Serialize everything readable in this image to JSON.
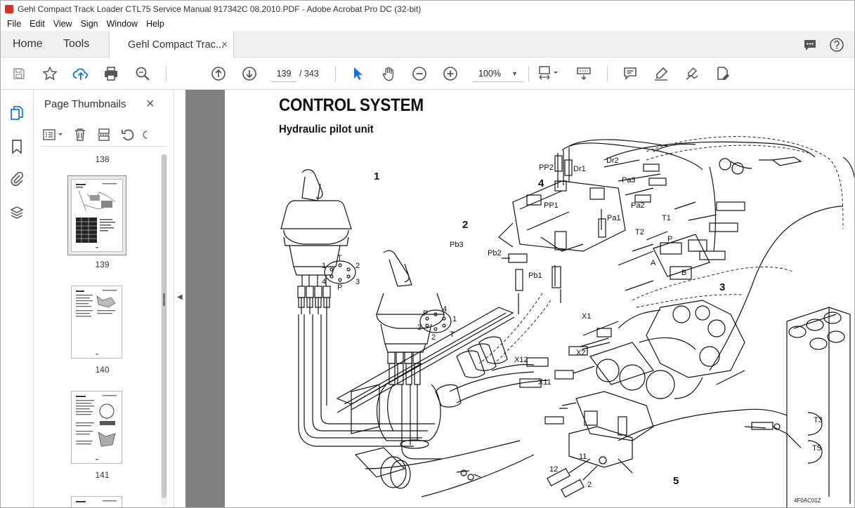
{
  "window": {
    "title": "Gehl Compact Track Loader CTL75 Service Manual 917342C 08.2010.PDF - Adobe Acrobat Pro DC (32-bit)"
  },
  "menu": [
    "File",
    "Edit",
    "View",
    "Sign",
    "Window",
    "Help"
  ],
  "tabs": {
    "home": "Home",
    "tools": "Tools",
    "document": "Gehl Compact Trac...",
    "close": "×"
  },
  "toolbar": {
    "current_page": "139",
    "total_pages": "/ 343",
    "zoom": "100%",
    "icons": [
      "save-icon",
      "bookmark-star-icon",
      "upload-icon",
      "print-icon",
      "find-icon",
      "prev-page-icon",
      "next-page-icon",
      "select-pointer-icon",
      "hand-icon",
      "zoom-out-icon",
      "zoom-in-icon",
      "page-fit-icon",
      "scroll-mode-icon",
      "comment-icon",
      "highlight-icon",
      "sign-icon",
      "edit-pdf-icon"
    ]
  },
  "left_rail": {
    "icons": [
      "pages-icon",
      "bookmark-icon",
      "attachment-icon",
      "layers-icon"
    ]
  },
  "thumbnails_panel": {
    "title": "Page Thumbnails",
    "close": "×",
    "pages": [
      {
        "label": "138"
      },
      {
        "label": "139",
        "selected": true
      },
      {
        "label": "140"
      },
      {
        "label": "141"
      }
    ]
  },
  "document": {
    "heading": "CONTROL SYSTEM",
    "subheading": "Hydraulic pilot unit",
    "diagram": {
      "callouts": [
        "1",
        "2",
        "3",
        "4",
        "5"
      ],
      "port_labels": [
        "PP2",
        "Dr1",
        "Dr2",
        "Pa3",
        "PP1",
        "Pa2",
        "Pa1",
        "T1",
        "T2",
        "P",
        "A",
        "B",
        "Pb3",
        "Pb2",
        "Pb1",
        "X1",
        "X2",
        "X12",
        "X11",
        "T3",
        "T5",
        "11",
        "12",
        "2"
      ],
      "pattern_left": {
        "labels": [
          "T",
          "1",
          "2",
          "4",
          "3",
          "P"
        ]
      },
      "pattern_right": {
        "labels": [
          "P",
          "4",
          "1",
          "3",
          "2",
          "T"
        ]
      },
      "figure_code": "4F0AC01Z"
    }
  }
}
